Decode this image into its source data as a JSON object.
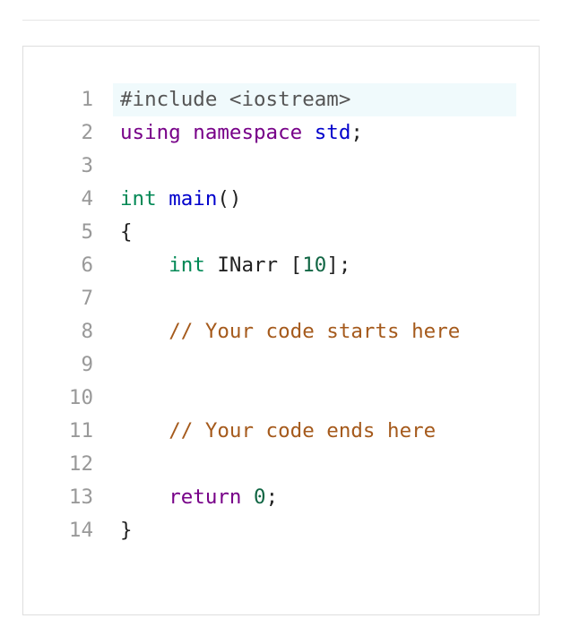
{
  "editor": {
    "language": "C++",
    "active_line": 1,
    "lines": [
      {
        "number": "1",
        "tokens": [
          {
            "text": "#include <iostream>",
            "type": "meta"
          }
        ]
      },
      {
        "number": "2",
        "tokens": [
          {
            "text": "using",
            "type": "keyword"
          },
          {
            "text": " ",
            "type": "plain"
          },
          {
            "text": "namespace",
            "type": "keyword"
          },
          {
            "text": " ",
            "type": "plain"
          },
          {
            "text": "std",
            "type": "variable"
          },
          {
            "text": ";",
            "type": "plain"
          }
        ]
      },
      {
        "number": "3",
        "tokens": []
      },
      {
        "number": "4",
        "tokens": [
          {
            "text": "int",
            "type": "type"
          },
          {
            "text": " ",
            "type": "plain"
          },
          {
            "text": "main",
            "type": "def"
          },
          {
            "text": "()",
            "type": "plain"
          }
        ]
      },
      {
        "number": "5",
        "tokens": [
          {
            "text": "{",
            "type": "plain"
          }
        ]
      },
      {
        "number": "6",
        "tokens": [
          {
            "text": "    ",
            "type": "plain"
          },
          {
            "text": "int",
            "type": "type"
          },
          {
            "text": " INarr [",
            "type": "plain"
          },
          {
            "text": "10",
            "type": "number"
          },
          {
            "text": "];",
            "type": "plain"
          }
        ]
      },
      {
        "number": "7",
        "tokens": []
      },
      {
        "number": "8",
        "tokens": [
          {
            "text": "    ",
            "type": "plain"
          },
          {
            "text": "// Your code starts here",
            "type": "comment"
          }
        ]
      },
      {
        "number": "9",
        "tokens": []
      },
      {
        "number": "10",
        "tokens": []
      },
      {
        "number": "11",
        "tokens": [
          {
            "text": "    ",
            "type": "plain"
          },
          {
            "text": "// Your code ends here",
            "type": "comment"
          }
        ]
      },
      {
        "number": "12",
        "tokens": []
      },
      {
        "number": "13",
        "tokens": [
          {
            "text": "    ",
            "type": "plain"
          },
          {
            "text": "return",
            "type": "keyword"
          },
          {
            "text": " ",
            "type": "plain"
          },
          {
            "text": "0",
            "type": "number"
          },
          {
            "text": ";",
            "type": "plain"
          }
        ]
      },
      {
        "number": "14",
        "tokens": [
          {
            "text": "}",
            "type": "plain"
          }
        ]
      }
    ]
  },
  "colors": {
    "keyword": "#770088",
    "type": "#008855",
    "def": "#0000cc",
    "number": "#116644",
    "comment": "#a55a1c",
    "meta": "#555555",
    "line_number": "#999999",
    "active_line_bg": "#f0fafc"
  }
}
